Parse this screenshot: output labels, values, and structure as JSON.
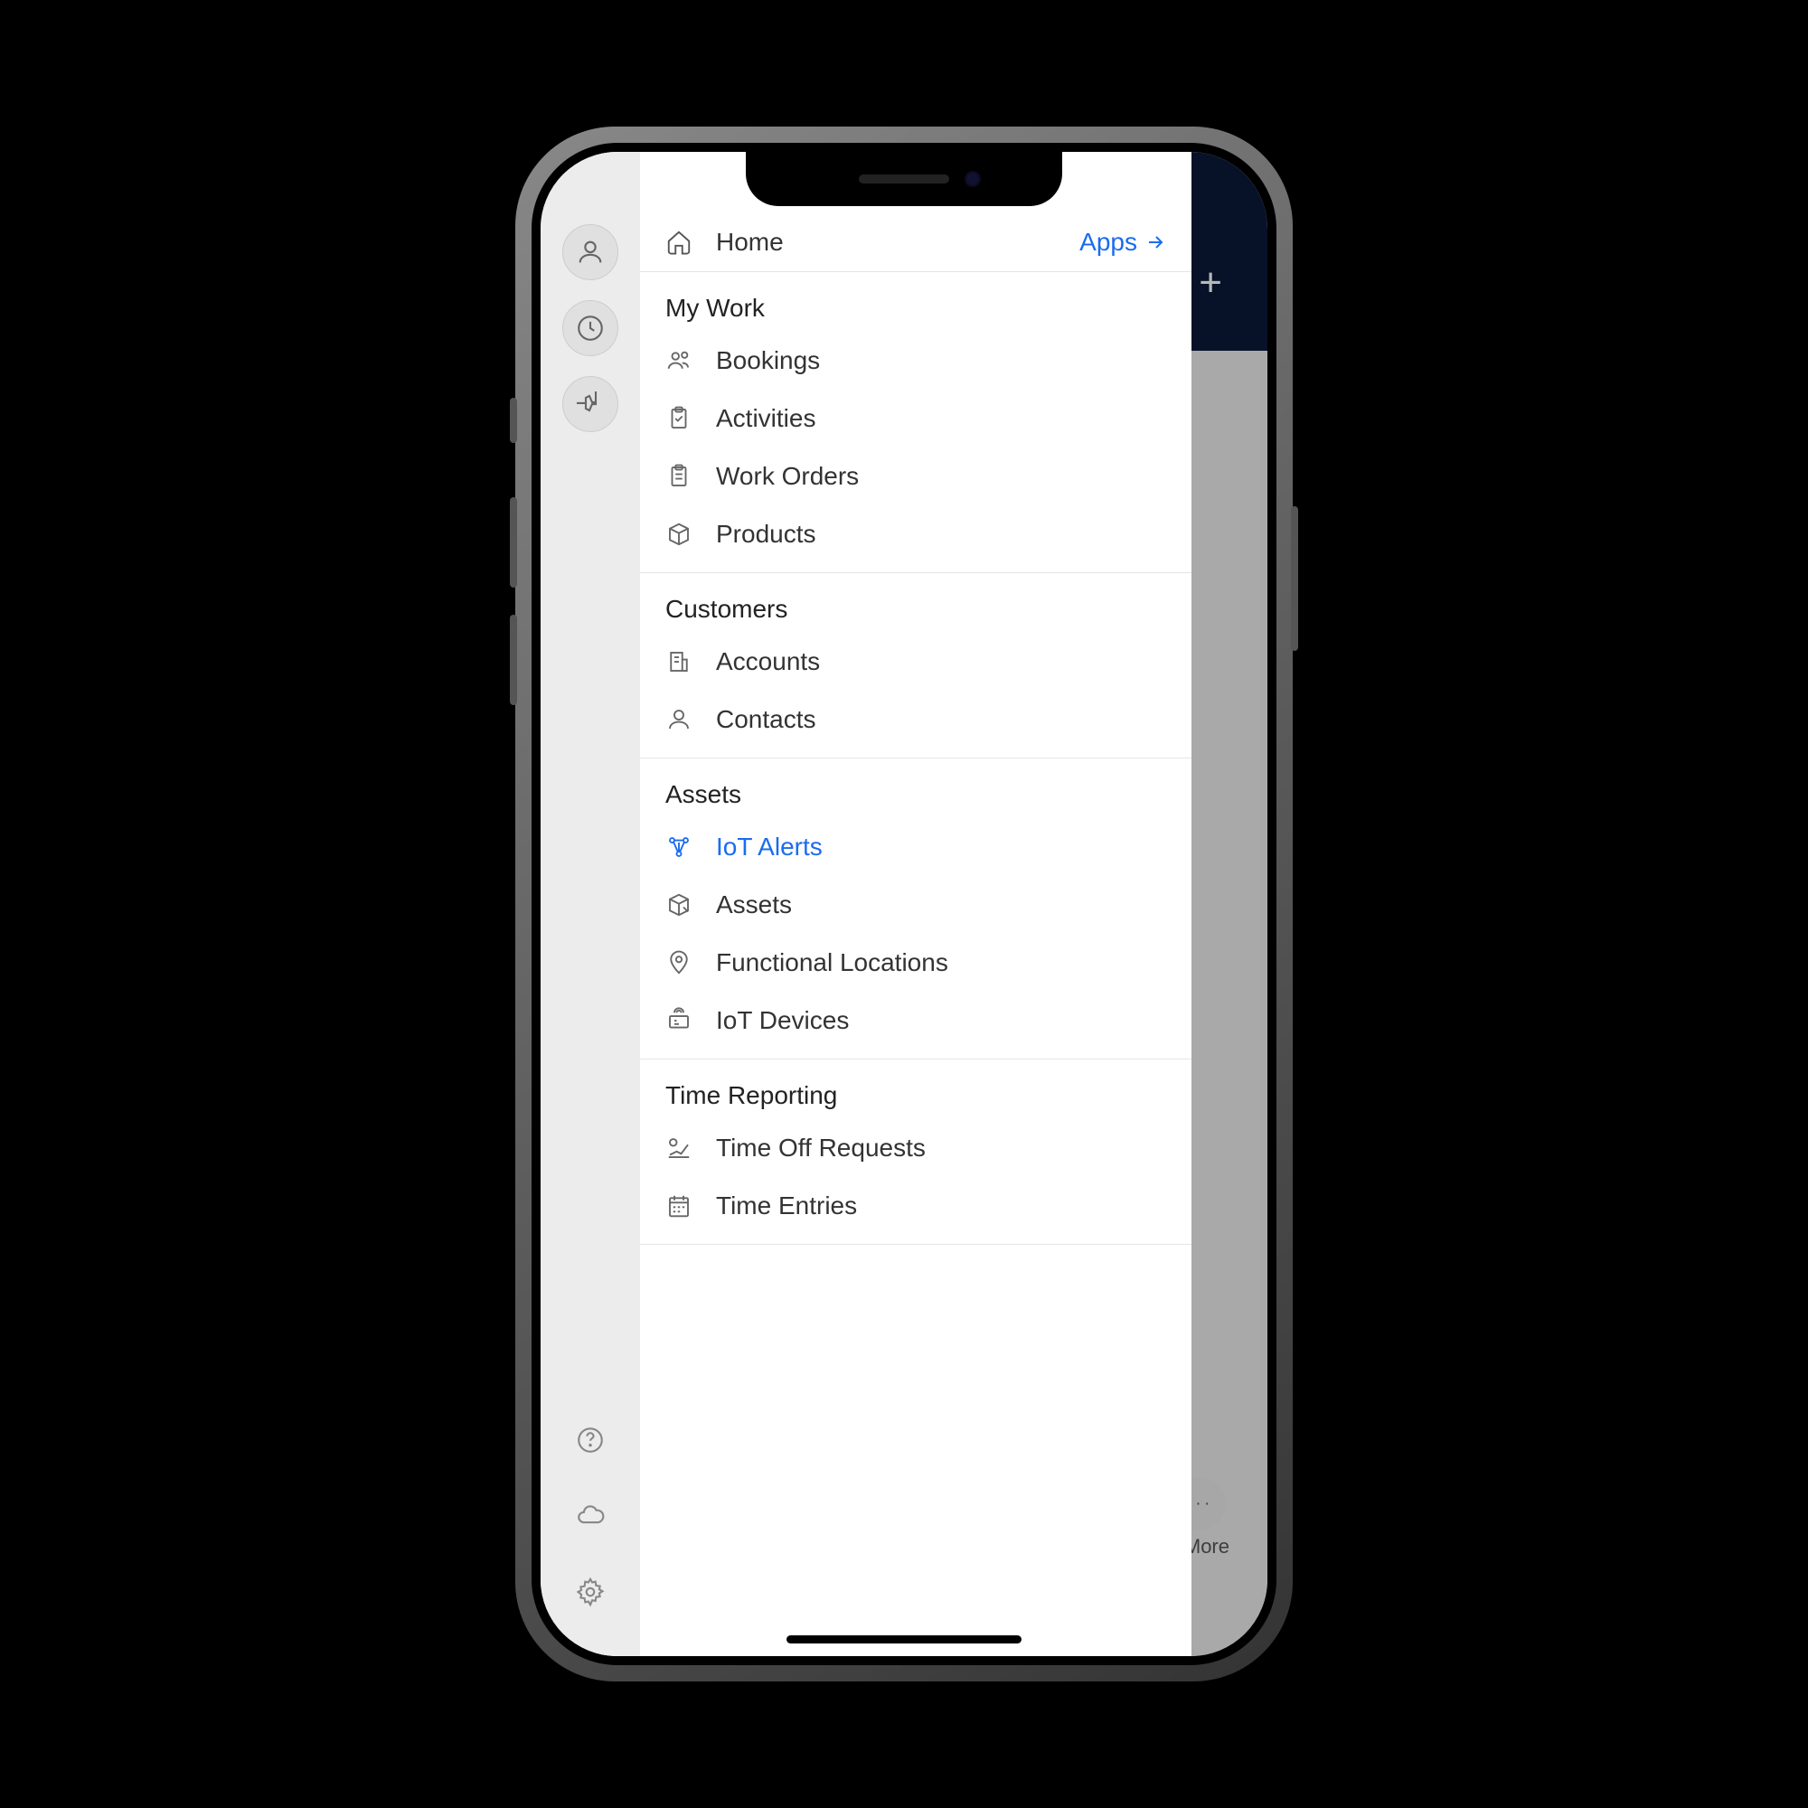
{
  "home": {
    "label": "Home",
    "apps_link": "Apps"
  },
  "sections": {
    "myWork": {
      "header": "My Work",
      "items": {
        "bookings": "Bookings",
        "activities": "Activities",
        "workOrders": "Work Orders",
        "products": "Products"
      }
    },
    "customers": {
      "header": "Customers",
      "items": {
        "accounts": "Accounts",
        "contacts": "Contacts"
      }
    },
    "assets": {
      "header": "Assets",
      "items": {
        "iotAlerts": "IoT Alerts",
        "assets": "Assets",
        "functionalLocations": "Functional Locations",
        "iotDevices": "IoT Devices"
      }
    },
    "timeReporting": {
      "header": "Time Reporting",
      "items": {
        "timeOffRequests": "Time Off Requests",
        "timeEntries": "Time Entries"
      }
    }
  },
  "background": {
    "more_label": "More"
  }
}
